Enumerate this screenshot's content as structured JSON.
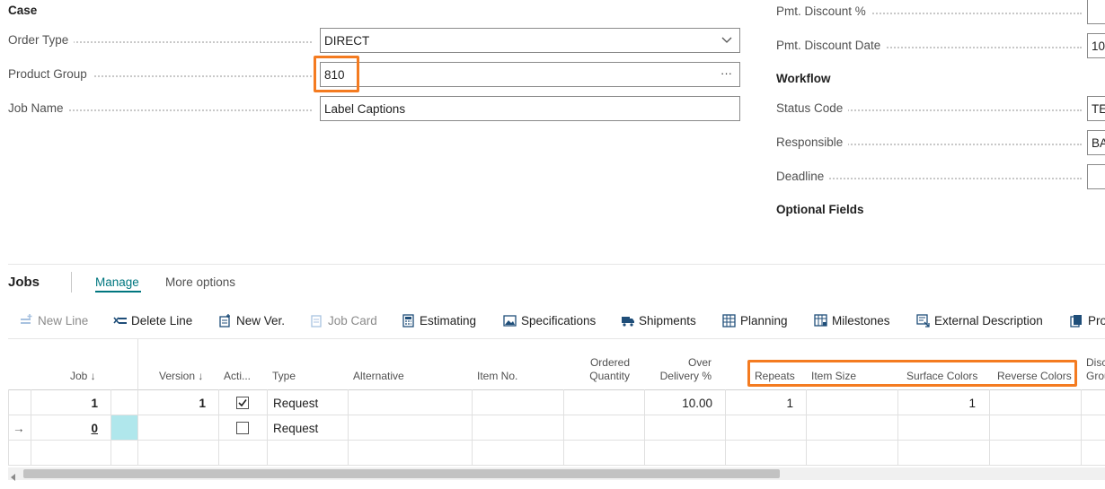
{
  "general": {
    "case_title": "Case",
    "order_type_label": "Order Type",
    "order_type_value": "DIRECT",
    "product_group_label": "Product Group",
    "product_group_value": "810",
    "job_name_label": "Job Name",
    "job_name_value": "Label Captions"
  },
  "right_panel": {
    "pmt_discount_label": "Pmt. Discount %",
    "pmt_discount_value": "",
    "pmt_discount_date_label": "Pmt. Discount Date",
    "pmt_discount_date_value": "10",
    "workflow_title": "Workflow",
    "status_code_label": "Status Code",
    "status_code_value": "TE",
    "responsible_label": "Responsible",
    "responsible_value": "BA",
    "deadline_label": "Deadline",
    "deadline_value": "",
    "optional_fields_title": "Optional Fields"
  },
  "jobs": {
    "title": "Jobs",
    "tabs": [
      "Manage",
      "More options"
    ],
    "actions": {
      "new_line": "New Line",
      "delete_line": "Delete Line",
      "new_ver": "New Ver.",
      "job_card": "Job Card",
      "estimating": "Estimating",
      "specifications": "Specifications",
      "shipments": "Shipments",
      "planning": "Planning",
      "milestones": "Milestones",
      "external_description": "External Description",
      "pro": "Pro"
    },
    "columns": {
      "job": "Job ↓",
      "version": "Version ↓",
      "active": "Acti...",
      "type": "Type",
      "alternative": "Alternative",
      "item_no": "Item No.",
      "ordered_quantity_1": "Ordered",
      "ordered_quantity_2": "Quantity",
      "over_delivery_1": "Over",
      "over_delivery_2": "Delivery %",
      "repeats": "Repeats",
      "item_size": "Item Size",
      "surface_colors": "Surface Colors",
      "reverse_colors": "Reverse Colors",
      "disc_1": "Disc",
      "disc_2": "Grou"
    },
    "rows": [
      {
        "job": "1",
        "version": "1",
        "active": true,
        "type": "Request",
        "over_delivery": "10.00",
        "repeats": "1",
        "surface_colors": "1"
      },
      {
        "job": "0",
        "version": "",
        "active": false,
        "type": "Request",
        "over_delivery": "",
        "repeats": "",
        "surface_colors": ""
      }
    ],
    "row_arrow": "→"
  },
  "colors": {
    "accent": "#f47b20",
    "link": "#00767f",
    "selected_cell": "#b0e7ec"
  }
}
